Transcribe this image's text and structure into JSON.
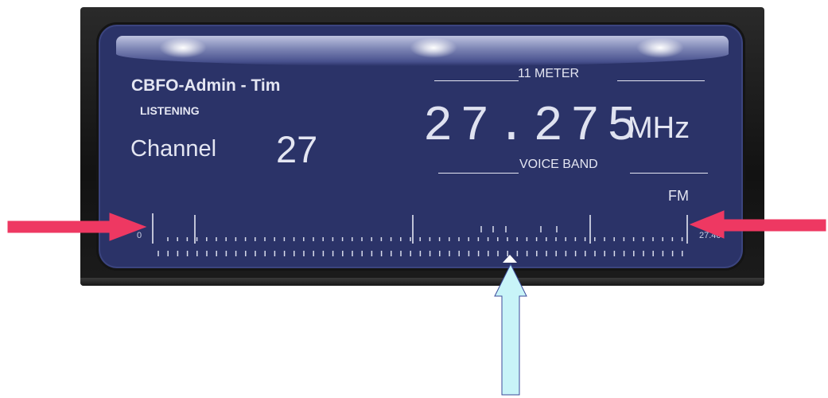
{
  "radio": {
    "station": "CBFO-Admin - Tim",
    "mode": "LISTENING",
    "channel_label": "Channel",
    "channel_number": "27",
    "frequency": "27.275",
    "frequency_unit": "MHz",
    "band_top": "11 METER",
    "band_bottom": "VOICE BAND",
    "modulation": "FM"
  },
  "scale": {
    "left_label": "0",
    "right_label": "27.40"
  },
  "colors": {
    "panel": "#2b3368",
    "text": "#e4e6f2",
    "annotation_red": "#ee3862",
    "annotation_cyan": "#c8f4f8"
  }
}
